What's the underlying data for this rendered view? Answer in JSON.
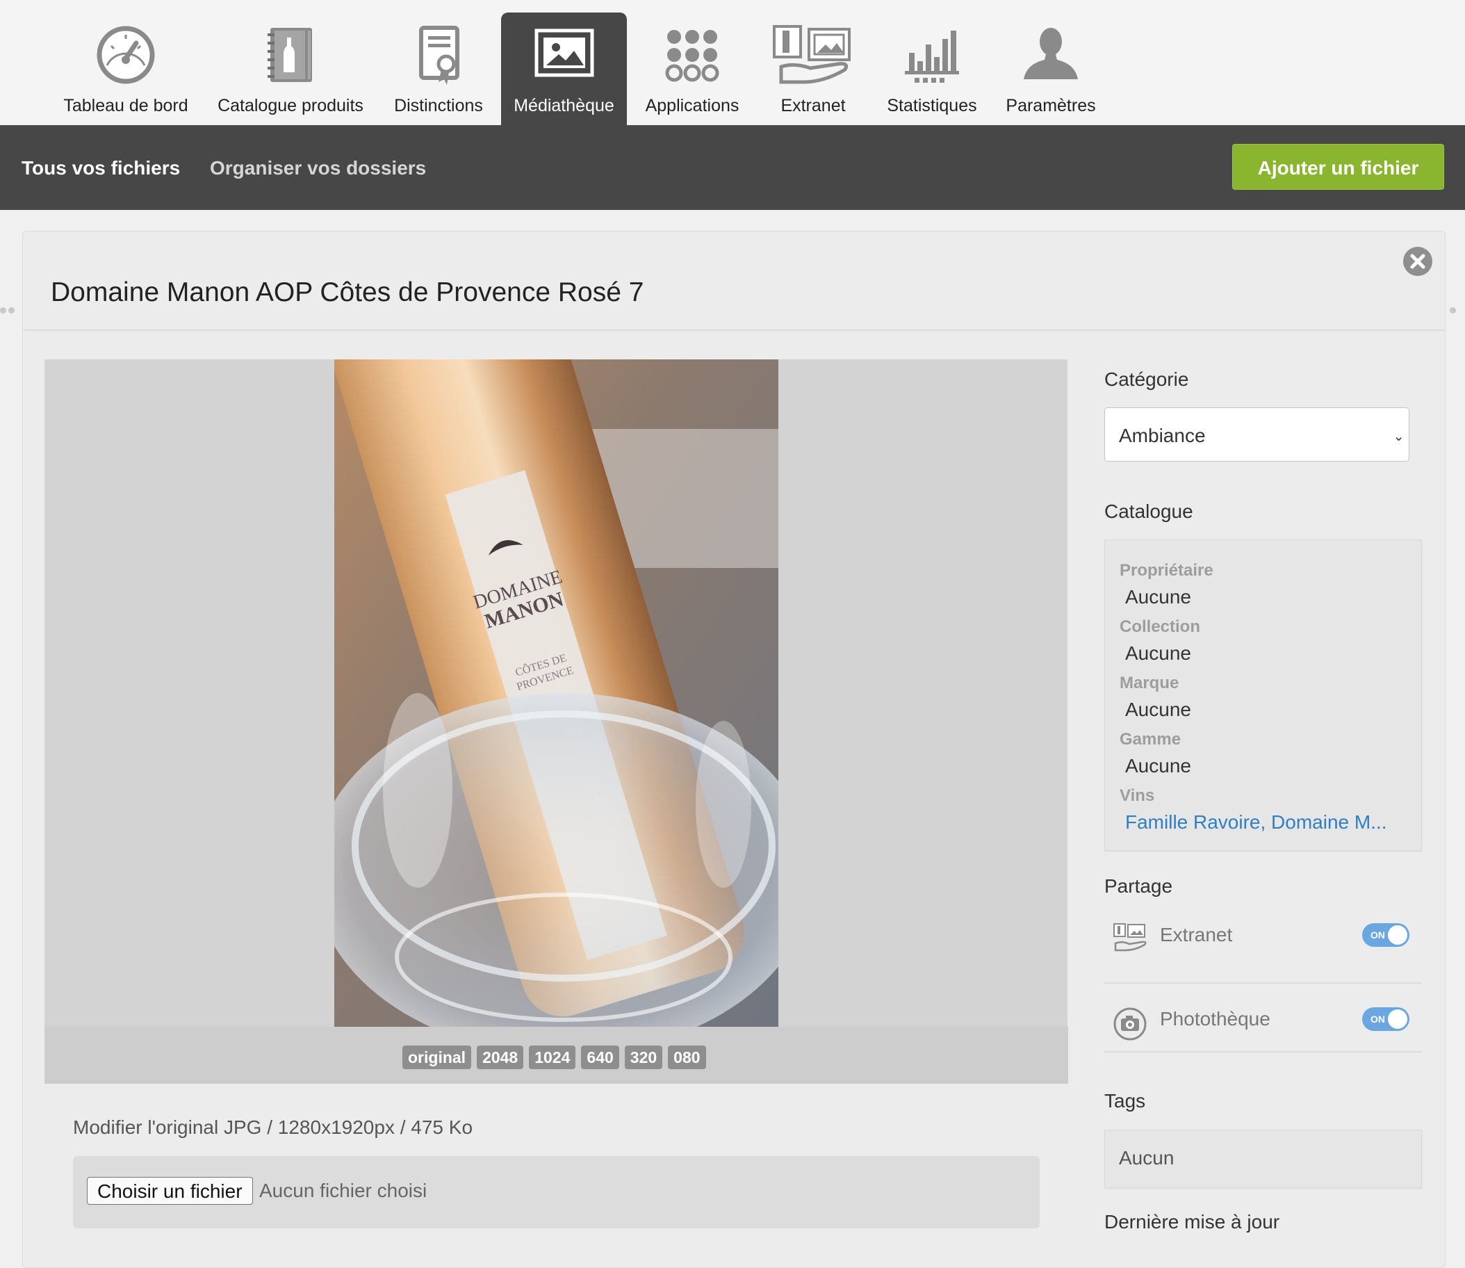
{
  "nav": {
    "items": [
      {
        "label": "Tableau de bord",
        "icon": "dashboard-gauge-icon"
      },
      {
        "label": "Catalogue produits",
        "icon": "product-catalog-icon"
      },
      {
        "label": "Distinctions",
        "icon": "award-certificate-icon"
      },
      {
        "label": "Médiathèque",
        "icon": "media-library-icon",
        "active": true
      },
      {
        "label": "Applications",
        "icon": "apps-grid-icon"
      },
      {
        "label": "Extranet",
        "icon": "extranet-icon"
      },
      {
        "label": "Statistiques",
        "icon": "bar-chart-icon"
      },
      {
        "label": "Paramètres",
        "icon": "user-settings-icon"
      }
    ]
  },
  "subnav": {
    "all_files": "Tous vos fichiers",
    "organize_folders": "Organiser vos dossiers",
    "add_file": "Ajouter un fichier"
  },
  "modal": {
    "title": "Domaine Manon AOP Côtes de Provence Rosé 7",
    "sizes": [
      "original",
      "2048",
      "1024",
      "640",
      "320",
      "080"
    ],
    "original_info": "Modifier l'original JPG / 1280x1920px / 475 Ko",
    "file_button": "Choisir un fichier",
    "file_none": "Aucun fichier choisi",
    "photo_label": {
      "line1": "DOMAINE",
      "line2": "MANON",
      "line3": "CÔTES DE",
      "line4": "PROVENCE"
    }
  },
  "panel": {
    "category_label": "Catégorie",
    "category_value": "Ambiance",
    "catalogue_label": "Catalogue",
    "catalogue": [
      {
        "label": "Propriétaire",
        "value": "Aucune"
      },
      {
        "label": "Collection",
        "value": "Aucune"
      },
      {
        "label": "Marque",
        "value": "Aucune"
      },
      {
        "label": "Gamme",
        "value": "Aucune"
      },
      {
        "label": "Vins",
        "value": "Famille Ravoire, Domaine M..."
      }
    ],
    "share_label": "Partage",
    "share": [
      {
        "name": "Extranet",
        "state": "ON",
        "enabled": true
      },
      {
        "name": "Photothèque",
        "state": "ON",
        "enabled": true
      }
    ],
    "tags_label": "Tags",
    "tags_value": "Aucun",
    "updated_label": "Dernière mise à jour"
  },
  "colors": {
    "accent_green": "#8ab52f",
    "nav_dark": "#474747",
    "link_blue": "#2f7fc3",
    "toggle_blue": "#6aa7e0"
  }
}
